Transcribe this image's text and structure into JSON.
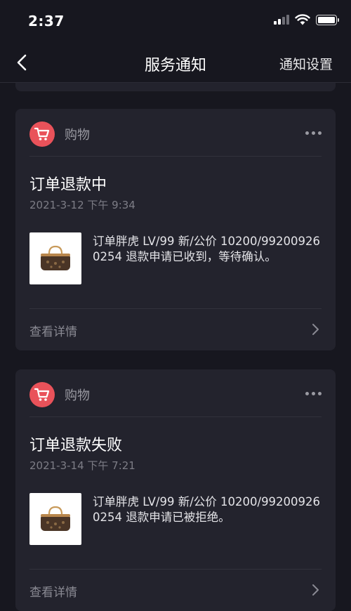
{
  "status_bar": {
    "time": "2:37"
  },
  "nav": {
    "title": "服务通知",
    "settings_label": "通知设置"
  },
  "cards": [
    {
      "category": "购物",
      "title": "订单退款中",
      "time": "2021-3-12 下午 9:34",
      "message": "订单胖虎 LV/99 新/公价 10200/992009260254 退款申请已收到，等待确认。",
      "detail_label": "查看详情"
    },
    {
      "category": "购物",
      "title": "订单退款失败",
      "time": "2021-3-14 下午 7:21",
      "message": "订单胖虎 LV/99 新/公价 10200/992009260254 退款申请已被拒绝。",
      "detail_label": "查看详情"
    }
  ],
  "icons": {
    "back": "chevron-left-icon",
    "category": "shopping-cart-icon",
    "more": "more-dots-icon",
    "detail": "chevron-right-icon",
    "product": "handbag-image"
  },
  "colors": {
    "accent": "#e9525a",
    "background": "#17171f",
    "card": "#23232d"
  }
}
